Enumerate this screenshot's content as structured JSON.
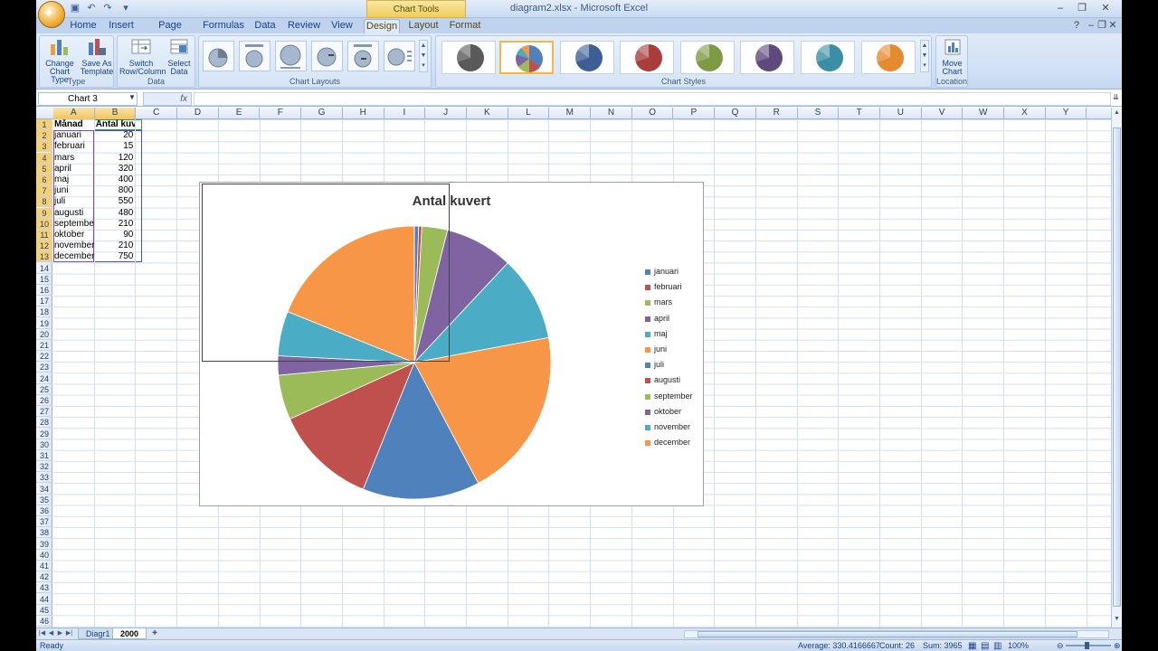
{
  "window": {
    "context_tab": "Chart Tools",
    "title": "diagram2.xlsx - Microsoft Excel"
  },
  "tabs": [
    "Home",
    "Insert",
    "Page Layout",
    "Formulas",
    "Data",
    "Review",
    "View",
    "Design",
    "Layout",
    "Format"
  ],
  "active_tab": "Design",
  "ribbon": {
    "type_group": {
      "label": "Type",
      "buttons": [
        {
          "l1": "Change",
          "l2": "Chart Type"
        },
        {
          "l1": "Save As",
          "l2": "Template"
        }
      ]
    },
    "data_group": {
      "label": "Data",
      "buttons": [
        {
          "l1": "Switch",
          "l2": "Row/Column"
        },
        {
          "l1": "Select",
          "l2": "Data"
        }
      ]
    },
    "layouts_group": {
      "label": "Chart Layouts"
    },
    "styles_group": {
      "label": "Chart Styles",
      "style_colors": [
        "#5a5a5a",
        "#4f81bd",
        "#3d5f95",
        "#a83d3b",
        "#7f9a45",
        "#5e4a7d",
        "#3b8ea3",
        "#e68a30"
      ]
    },
    "location_group": {
      "label": "Location",
      "button": {
        "l1": "Move",
        "l2": "Chart"
      }
    }
  },
  "formula_bar": {
    "name_box": "Chart 3",
    "fx": "fx",
    "formula": ""
  },
  "columns": [
    "A",
    "B",
    "C",
    "D",
    "E",
    "F",
    "G",
    "H",
    "I",
    "J",
    "K",
    "L",
    "M",
    "N",
    "O",
    "P",
    "Q",
    "R",
    "S",
    "T",
    "U",
    "V",
    "W",
    "X",
    "Y"
  ],
  "rows_count": 46,
  "table": {
    "headers": [
      "Månad",
      "Antal kuvert"
    ],
    "rows": [
      [
        "januari",
        "20"
      ],
      [
        "februari",
        "15"
      ],
      [
        "mars",
        "120"
      ],
      [
        "april",
        "320"
      ],
      [
        "maj",
        "400"
      ],
      [
        "juni",
        "800"
      ],
      [
        "juli",
        "550"
      ],
      [
        "augusti",
        "480"
      ],
      [
        "september",
        "210"
      ],
      [
        "oktober",
        "90"
      ],
      [
        "november",
        "210"
      ],
      [
        "december",
        "750"
      ]
    ]
  },
  "chart_data": {
    "type": "pie",
    "title": "Antal kuvert",
    "categories": [
      "januari",
      "februari",
      "mars",
      "april",
      "maj",
      "juni",
      "juli",
      "augusti",
      "september",
      "oktober",
      "november",
      "december"
    ],
    "values": [
      20,
      15,
      120,
      320,
      400,
      800,
      550,
      480,
      210,
      90,
      210,
      750
    ],
    "colors": [
      "#4f81bd",
      "#c0504d",
      "#9bbb59",
      "#8064a2",
      "#4bacc6",
      "#f79646",
      "#4f81bd",
      "#c0504d",
      "#9bbb59",
      "#8064a2",
      "#4bacc6",
      "#f79646"
    ],
    "legend_position": "right"
  },
  "sheets": [
    "Diagr1",
    "2000"
  ],
  "active_sheet": "2000",
  "status": {
    "mode": "Ready",
    "average": "Average: 330.4166667",
    "count": "Count: 26",
    "sum": "Sum: 3965",
    "zoom": "100%"
  }
}
